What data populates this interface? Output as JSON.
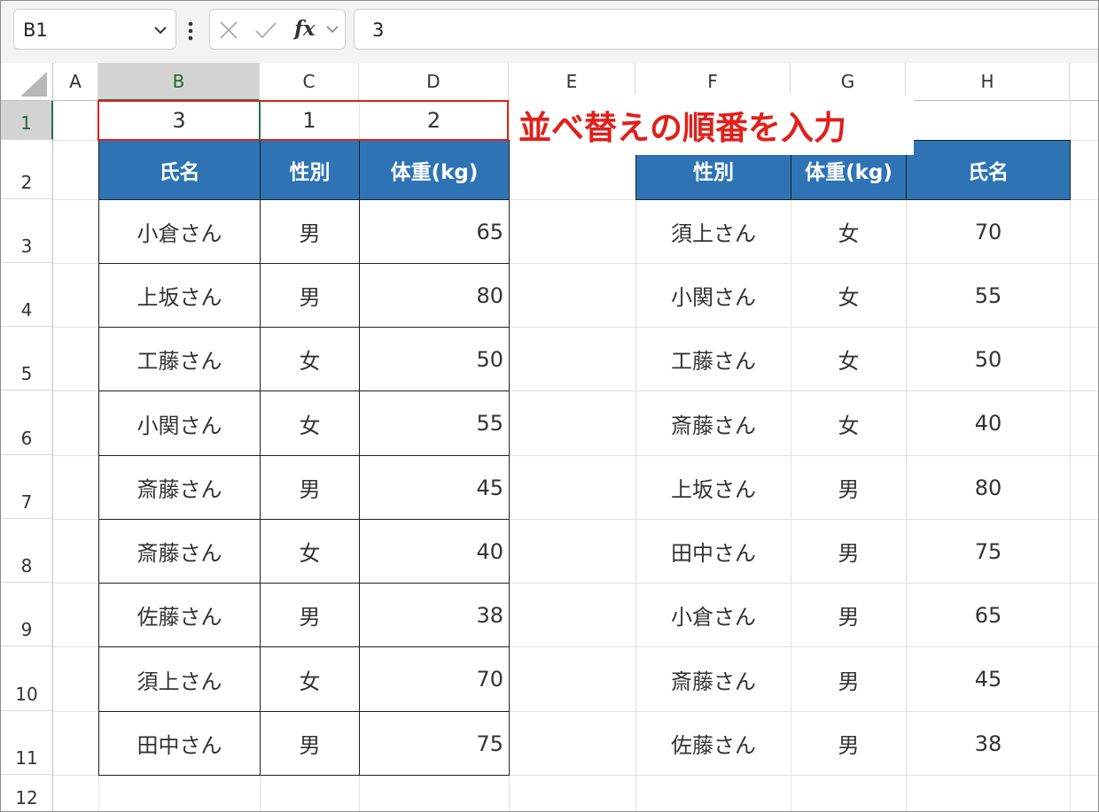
{
  "formula_bar": {
    "name_box": "B1",
    "fx_label": "fx",
    "value": "3"
  },
  "columns": [
    "A",
    "B",
    "C",
    "D",
    "E",
    "F",
    "G",
    "H"
  ],
  "rows": [
    "1",
    "2",
    "3",
    "4",
    "5",
    "6",
    "7",
    "8",
    "9",
    "10",
    "11",
    "12"
  ],
  "row1": {
    "b": "3",
    "c": "1",
    "d": "2"
  },
  "callout": "並べ替えの順番を入力",
  "left_table": {
    "headers": [
      "氏名",
      "性別",
      "体重(kg)"
    ],
    "rows": [
      [
        "小倉さん",
        "男",
        "65"
      ],
      [
        "上坂さん",
        "男",
        "80"
      ],
      [
        "工藤さん",
        "女",
        "50"
      ],
      [
        "小関さん",
        "女",
        "55"
      ],
      [
        "斎藤さん",
        "男",
        "45"
      ],
      [
        "斎藤さん",
        "女",
        "40"
      ],
      [
        "佐藤さん",
        "男",
        "38"
      ],
      [
        "須上さん",
        "女",
        "70"
      ],
      [
        "田中さん",
        "男",
        "75"
      ]
    ]
  },
  "right_table": {
    "headers": [
      "性別",
      "体重(kg)",
      "氏名"
    ],
    "rows": [
      [
        "須上さん",
        "女",
        "70"
      ],
      [
        "小関さん",
        "女",
        "55"
      ],
      [
        "工藤さん",
        "女",
        "50"
      ],
      [
        "斎藤さん",
        "女",
        "40"
      ],
      [
        "上坂さん",
        "男",
        "80"
      ],
      [
        "田中さん",
        "男",
        "75"
      ],
      [
        "小倉さん",
        "男",
        "65"
      ],
      [
        "斎藤さん",
        "男",
        "45"
      ],
      [
        "佐藤さん",
        "男",
        "38"
      ]
    ]
  },
  "colors": {
    "header_fill": "#2e74b5",
    "callout": "#e0201b",
    "selection": "#217346"
  }
}
